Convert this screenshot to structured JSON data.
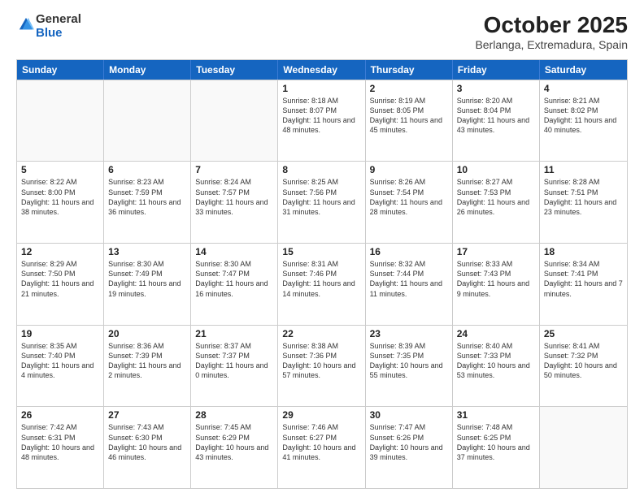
{
  "logo": {
    "general": "General",
    "blue": "Blue"
  },
  "title": "October 2025",
  "subtitle": "Berlanga, Extremadura, Spain",
  "headers": [
    "Sunday",
    "Monday",
    "Tuesday",
    "Wednesday",
    "Thursday",
    "Friday",
    "Saturday"
  ],
  "rows": [
    [
      {
        "day": "",
        "info": ""
      },
      {
        "day": "",
        "info": ""
      },
      {
        "day": "",
        "info": ""
      },
      {
        "day": "1",
        "info": "Sunrise: 8:18 AM\nSunset: 8:07 PM\nDaylight: 11 hours and 48 minutes."
      },
      {
        "day": "2",
        "info": "Sunrise: 8:19 AM\nSunset: 8:05 PM\nDaylight: 11 hours and 45 minutes."
      },
      {
        "day": "3",
        "info": "Sunrise: 8:20 AM\nSunset: 8:04 PM\nDaylight: 11 hours and 43 minutes."
      },
      {
        "day": "4",
        "info": "Sunrise: 8:21 AM\nSunset: 8:02 PM\nDaylight: 11 hours and 40 minutes."
      }
    ],
    [
      {
        "day": "5",
        "info": "Sunrise: 8:22 AM\nSunset: 8:00 PM\nDaylight: 11 hours and 38 minutes."
      },
      {
        "day": "6",
        "info": "Sunrise: 8:23 AM\nSunset: 7:59 PM\nDaylight: 11 hours and 36 minutes."
      },
      {
        "day": "7",
        "info": "Sunrise: 8:24 AM\nSunset: 7:57 PM\nDaylight: 11 hours and 33 minutes."
      },
      {
        "day": "8",
        "info": "Sunrise: 8:25 AM\nSunset: 7:56 PM\nDaylight: 11 hours and 31 minutes."
      },
      {
        "day": "9",
        "info": "Sunrise: 8:26 AM\nSunset: 7:54 PM\nDaylight: 11 hours and 28 minutes."
      },
      {
        "day": "10",
        "info": "Sunrise: 8:27 AM\nSunset: 7:53 PM\nDaylight: 11 hours and 26 minutes."
      },
      {
        "day": "11",
        "info": "Sunrise: 8:28 AM\nSunset: 7:51 PM\nDaylight: 11 hours and 23 minutes."
      }
    ],
    [
      {
        "day": "12",
        "info": "Sunrise: 8:29 AM\nSunset: 7:50 PM\nDaylight: 11 hours and 21 minutes."
      },
      {
        "day": "13",
        "info": "Sunrise: 8:30 AM\nSunset: 7:49 PM\nDaylight: 11 hours and 19 minutes."
      },
      {
        "day": "14",
        "info": "Sunrise: 8:30 AM\nSunset: 7:47 PM\nDaylight: 11 hours and 16 minutes."
      },
      {
        "day": "15",
        "info": "Sunrise: 8:31 AM\nSunset: 7:46 PM\nDaylight: 11 hours and 14 minutes."
      },
      {
        "day": "16",
        "info": "Sunrise: 8:32 AM\nSunset: 7:44 PM\nDaylight: 11 hours and 11 minutes."
      },
      {
        "day": "17",
        "info": "Sunrise: 8:33 AM\nSunset: 7:43 PM\nDaylight: 11 hours and 9 minutes."
      },
      {
        "day": "18",
        "info": "Sunrise: 8:34 AM\nSunset: 7:41 PM\nDaylight: 11 hours and 7 minutes."
      }
    ],
    [
      {
        "day": "19",
        "info": "Sunrise: 8:35 AM\nSunset: 7:40 PM\nDaylight: 11 hours and 4 minutes."
      },
      {
        "day": "20",
        "info": "Sunrise: 8:36 AM\nSunset: 7:39 PM\nDaylight: 11 hours and 2 minutes."
      },
      {
        "day": "21",
        "info": "Sunrise: 8:37 AM\nSunset: 7:37 PM\nDaylight: 11 hours and 0 minutes."
      },
      {
        "day": "22",
        "info": "Sunrise: 8:38 AM\nSunset: 7:36 PM\nDaylight: 10 hours and 57 minutes."
      },
      {
        "day": "23",
        "info": "Sunrise: 8:39 AM\nSunset: 7:35 PM\nDaylight: 10 hours and 55 minutes."
      },
      {
        "day": "24",
        "info": "Sunrise: 8:40 AM\nSunset: 7:33 PM\nDaylight: 10 hours and 53 minutes."
      },
      {
        "day": "25",
        "info": "Sunrise: 8:41 AM\nSunset: 7:32 PM\nDaylight: 10 hours and 50 minutes."
      }
    ],
    [
      {
        "day": "26",
        "info": "Sunrise: 7:42 AM\nSunset: 6:31 PM\nDaylight: 10 hours and 48 minutes."
      },
      {
        "day": "27",
        "info": "Sunrise: 7:43 AM\nSunset: 6:30 PM\nDaylight: 10 hours and 46 minutes."
      },
      {
        "day": "28",
        "info": "Sunrise: 7:45 AM\nSunset: 6:29 PM\nDaylight: 10 hours and 43 minutes."
      },
      {
        "day": "29",
        "info": "Sunrise: 7:46 AM\nSunset: 6:27 PM\nDaylight: 10 hours and 41 minutes."
      },
      {
        "day": "30",
        "info": "Sunrise: 7:47 AM\nSunset: 6:26 PM\nDaylight: 10 hours and 39 minutes."
      },
      {
        "day": "31",
        "info": "Sunrise: 7:48 AM\nSunset: 6:25 PM\nDaylight: 10 hours and 37 minutes."
      },
      {
        "day": "",
        "info": ""
      }
    ]
  ]
}
